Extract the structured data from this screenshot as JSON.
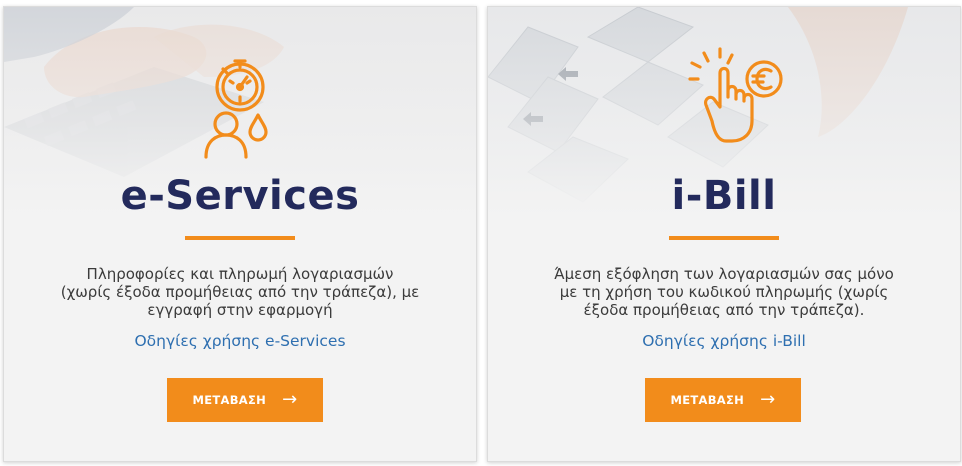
{
  "cards": [
    {
      "title": "e-Services",
      "description": "Πληροφορίες και πληρωμή λογαριασμών (χωρίς έξοδα προμήθειας από την τράπεζα), με εγγραφή στην εφαρμογή",
      "link_text": "Οδηγίες χρήσης e-Services",
      "button_label": "ΜΕΤΑΒΑΣΗ",
      "button_icon": "arrow-right-icon",
      "icon": "user-meter-icon"
    },
    {
      "title": "i-Bill",
      "description": "Άμεση εξόφληση των λογαριασμών σας μόνο με τη χρήση του κωδικού πληρωμής (χωρίς έξοδα προμήθειας από την τράπεζα).",
      "link_text": "Οδηγίες χρήσης i-Bill",
      "button_label": "ΜΕΤΑΒΑΣΗ",
      "button_icon": "arrow-right-icon",
      "icon": "tap-euro-icon"
    }
  ],
  "colors": {
    "accent": "#f28c1b",
    "title": "#232a5c",
    "link": "#2e6fb0",
    "card_bg": "#f3f3f3"
  }
}
